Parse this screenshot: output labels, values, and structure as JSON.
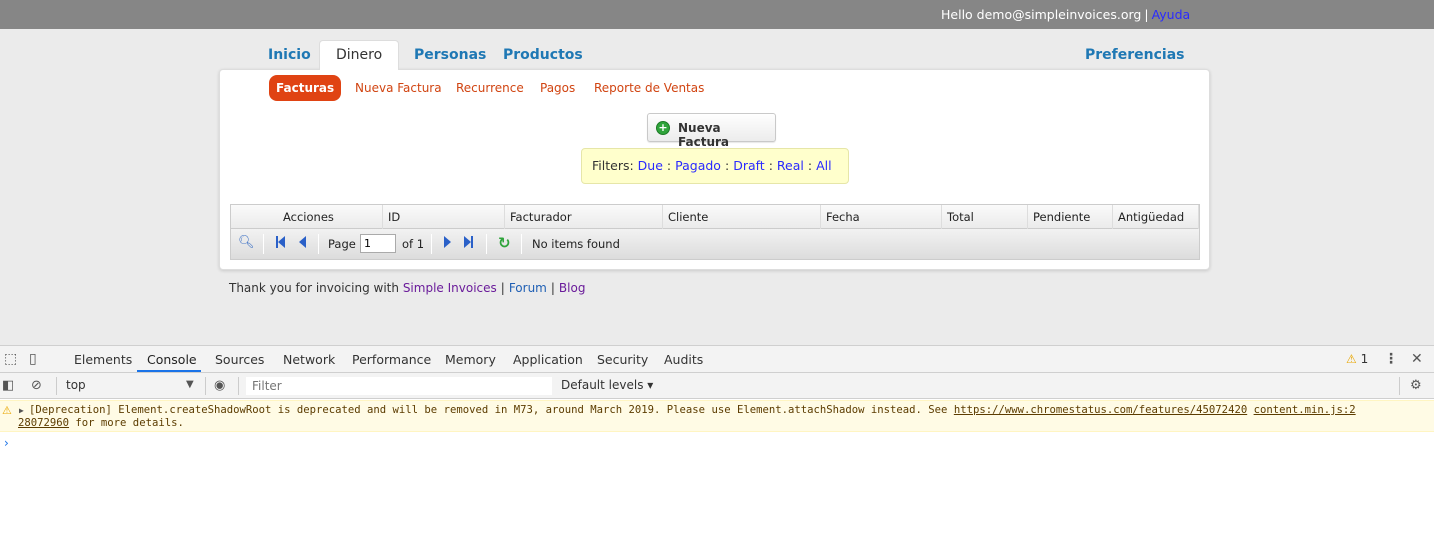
{
  "topbar": {
    "greeting": "Hello demo@simpleinvoices.org",
    "separator": "|",
    "help": "Ayuda"
  },
  "mainnav": {
    "inicio": "Inicio",
    "dinero": "Dinero",
    "personas": "Personas",
    "productos": "Productos",
    "preferencias": "Preferencias"
  },
  "subnav": {
    "facturas": "Facturas",
    "nueva": "Nueva Factura",
    "recurrence": "Recurrence",
    "pagos": "Pagos",
    "reporte": "Reporte de Ventas"
  },
  "new_invoice_button": "Nueva Factura",
  "filters": {
    "label": "Filters:",
    "due": "Due",
    "pagado": "Pagado",
    "draft": "Draft",
    "real": "Real",
    "all": "All",
    "colon": ":"
  },
  "grid": {
    "columns": [
      "Acciones",
      "ID",
      "Facturador",
      "Cliente",
      "Fecha",
      "Total",
      "Pendiente",
      "Antigüedad"
    ],
    "page_label": "Page",
    "page_value": "1",
    "of_label": "of 1",
    "empty": "No items found"
  },
  "footer": {
    "text": "Thank you for invoicing with",
    "simple": "Simple Invoices",
    "forum": "Forum",
    "blog": "Blog",
    "separator": "|"
  },
  "devtools": {
    "tabs": [
      "Elements",
      "Console",
      "Sources",
      "Network",
      "Performance",
      "Memory",
      "Application",
      "Security",
      "Audits"
    ],
    "active_tab": "Console",
    "warning_count": "1",
    "context": "top",
    "filter_placeholder": "Filter",
    "levels": "Default levels ▾",
    "message_line1": "[Deprecation] Element.createShadowRoot is deprecated and will be removed in M73, around March 2019. Please use Element.attachShadow instead. See ",
    "message_link1": "https://www.chromestatus.com/features/45072420",
    "message_link2a": "content.min.js:2",
    "message_link2b": "28072960",
    "message_line2": " for more details.",
    "prompt": "›"
  },
  "colors": {
    "accent": "#e04313",
    "link": "#1f78b4",
    "topbar": "#868686"
  }
}
